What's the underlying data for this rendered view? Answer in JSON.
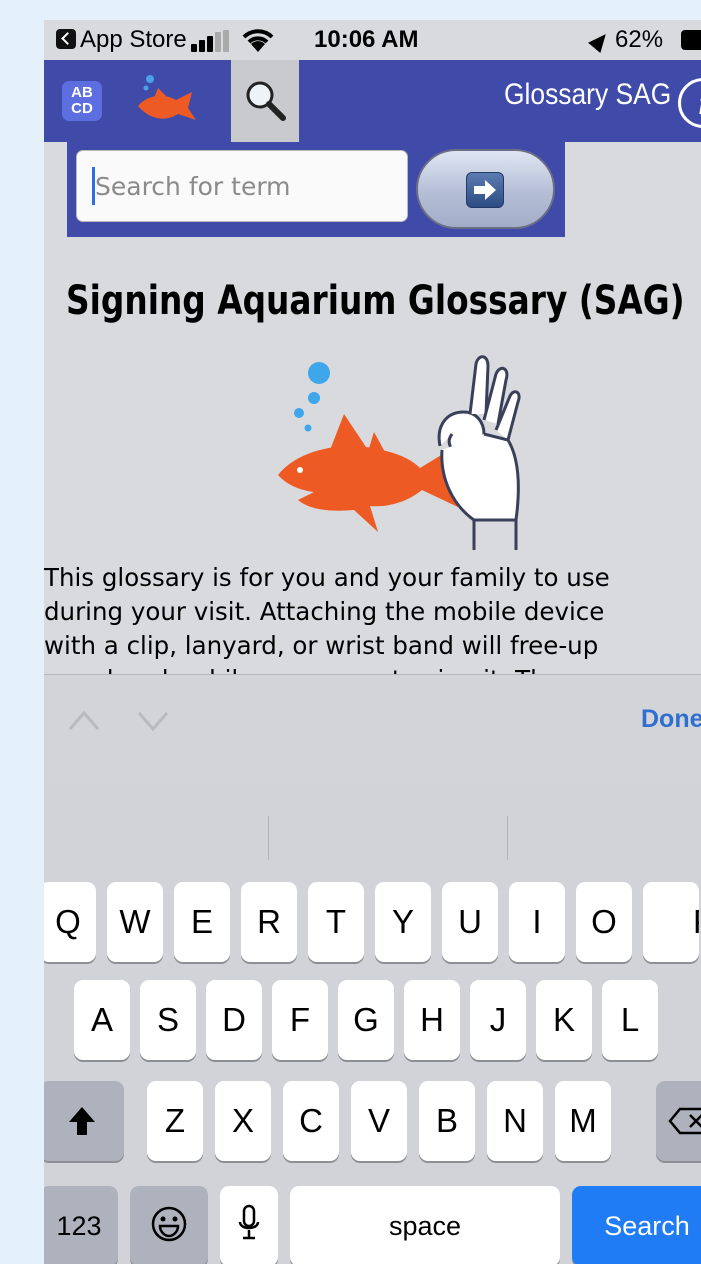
{
  "status_bar": {
    "back_app": "App Store",
    "time": "10:06 AM",
    "battery": "62%"
  },
  "header": {
    "tab_abcd_top": "AB",
    "tab_abcd_bottom": "CD",
    "title": "Glossary SAG",
    "info_label": "i"
  },
  "search": {
    "placeholder": "Search for term",
    "value": ""
  },
  "content": {
    "heading": "Signing Aquarium Glossary (SAG)",
    "intro": "This glossary is for you and your family to use\nduring your visit. Attaching the mobile device\nwith a clip, lanyard, or wrist band will free-up\nyour hands while you are not using it. The"
  },
  "accessory": {
    "done_label": "Done"
  },
  "keyboard": {
    "row1": [
      "Q",
      "W",
      "E",
      "R",
      "T",
      "Y",
      "U",
      "I",
      "O",
      "P"
    ],
    "row2": [
      "A",
      "S",
      "D",
      "F",
      "G",
      "H",
      "J",
      "K",
      "L"
    ],
    "row3": [
      "Z",
      "X",
      "C",
      "V",
      "B",
      "N",
      "M"
    ],
    "numbers_key": "123",
    "space_key": "space",
    "search_key": "Search",
    "icons": [
      "shift-icon",
      "backspace-icon",
      "emoji-icon",
      "microphone-icon"
    ]
  },
  "colors": {
    "app_bar": "#3f4aa9",
    "accent_blue": "#1f7cf5",
    "fish_orange": "#ee5a23"
  }
}
